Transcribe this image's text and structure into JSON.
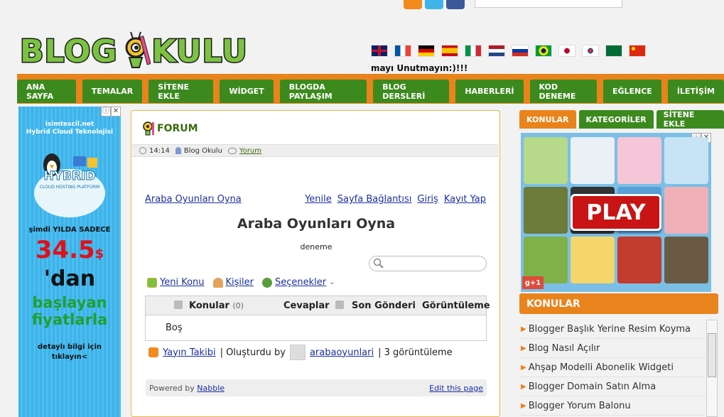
{
  "header": {
    "logo_text_left": "BLOG",
    "logo_text_right": "KULU",
    "marquee": "mayı Unutmayın:)!!!"
  },
  "nav": [
    "ANA SAYFA",
    "TEMALAR",
    "SİTENE EKLE",
    "WİDGET",
    "BLOGDA PAYLAŞIM",
    "BLOG DERSLERİ",
    "HABERLERİ",
    "KOD DENEME",
    "EĞLENCE",
    "İLETİŞİM"
  ],
  "left_ad": {
    "brand": "isimtescil.net",
    "tagline": "Hybrid Cloud Teknolojisi",
    "product": "HYBRID",
    "product_sub": "CLOUD HOSTING PLATFORM",
    "offer_line": "şimdi YILDA SADECE",
    "price": "34.5",
    "currency": "$",
    "from": "'dan",
    "start1": "başlayan",
    "start2": "fiyatlarla",
    "more": "detaylı bilgi için",
    "click": "tıklayın<"
  },
  "forum": {
    "label": "FORUM",
    "time": "14:14",
    "author": "Blog Okulu",
    "comment_link": "Yorum",
    "breadcrumb": "Araba Oyunları Oyna",
    "top_links": [
      "Yenile",
      "Sayfa Bağlantısı",
      "Giriş",
      "Kayıt Yap"
    ],
    "title": "Araba Oyunları Oyna",
    "description": "deneme",
    "actions": {
      "new_topic": "Yeni Konu",
      "people": "Kişiler",
      "options": "Seçenekler"
    },
    "table": {
      "col_topics": "Konular",
      "topics_count": "(0)",
      "col_replies": "Cevaplar",
      "col_last": "Son Gönderi",
      "col_views": "Görüntüleme",
      "empty": "Boş"
    },
    "footer": {
      "rss": "Yayın Takibi",
      "created_by": "| Oluşturdu by",
      "user": "arabaoyunlari",
      "views": "| 3 görüntüleme"
    },
    "powered_by": "Powered by",
    "nabble": "Nabble",
    "edit": "Edit this page"
  },
  "sidebar": {
    "tabs": [
      "KONULAR",
      "KATEGORİLER",
      "SİTENE EKLE"
    ],
    "play": "PLAY",
    "gplus": "g+1",
    "section_title": "KONULAR",
    "items": [
      "Blogger Başlık Yerine Resim Koyma",
      "Blog Nasıl Açılır",
      "Ahşap Modelli Abonelik Widgeti",
      "Blogger Domain Satın Alma",
      "Blogger Yorum Balonu"
    ]
  },
  "colors": {
    "orange": "#e9831c",
    "green": "#3c8a1e",
    "link": "#1b2fa0"
  }
}
